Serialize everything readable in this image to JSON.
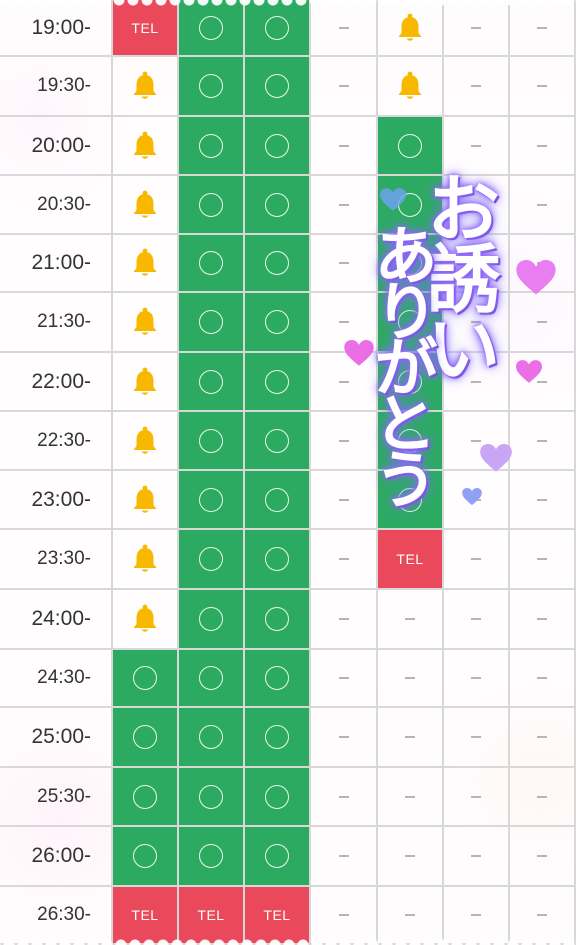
{
  "columns": [
    "c1",
    "c2",
    "c3",
    "c4",
    "c5",
    "c6",
    "c7"
  ],
  "rows": [
    {
      "time": "19:00-",
      "cells": [
        "tel",
        "circle",
        "circle",
        "dash",
        "bell",
        "dash",
        "dash"
      ]
    },
    {
      "time": "19:30-",
      "cells": [
        "bell",
        "circle",
        "circle",
        "dash",
        "bell",
        "dash",
        "dash"
      ]
    },
    {
      "time": "20:00-",
      "cells": [
        "bell",
        "circle",
        "circle",
        "dash",
        "circle",
        "dash",
        "dash"
      ]
    },
    {
      "time": "20:30-",
      "cells": [
        "bell",
        "circle",
        "circle",
        "dash",
        "circle",
        "dash",
        "dash"
      ]
    },
    {
      "time": "21:00-",
      "cells": [
        "bell",
        "circle",
        "circle",
        "dash",
        "circle",
        "dash",
        "dash"
      ]
    },
    {
      "time": "21:30-",
      "cells": [
        "bell",
        "circle",
        "circle",
        "dash",
        "circle",
        "dash",
        "dash"
      ]
    },
    {
      "time": "22:00-",
      "cells": [
        "bell",
        "circle",
        "circle",
        "dash",
        "circle",
        "dash",
        "dash"
      ]
    },
    {
      "time": "22:30-",
      "cells": [
        "bell",
        "circle",
        "circle",
        "dash",
        "circle",
        "dash",
        "dash"
      ]
    },
    {
      "time": "23:00-",
      "cells": [
        "bell",
        "circle",
        "circle",
        "dash",
        "circle",
        "dash",
        "dash"
      ]
    },
    {
      "time": "23:30-",
      "cells": [
        "bell",
        "circle",
        "circle",
        "dash",
        "tel",
        "dash",
        "dash"
      ]
    },
    {
      "time": "24:00-",
      "cells": [
        "bell",
        "circle",
        "circle",
        "dash",
        "dash",
        "dash",
        "dash"
      ]
    },
    {
      "time": "24:30-",
      "cells": [
        "circle",
        "circle",
        "circle",
        "dash",
        "dash",
        "dash",
        "dash"
      ]
    },
    {
      "time": "25:00-",
      "cells": [
        "circle",
        "circle",
        "circle",
        "dash",
        "dash",
        "dash",
        "dash"
      ]
    },
    {
      "time": "25:30-",
      "cells": [
        "circle",
        "circle",
        "circle",
        "dash",
        "dash",
        "dash",
        "dash"
      ]
    },
    {
      "time": "26:00-",
      "cells": [
        "circle",
        "circle",
        "circle",
        "dash",
        "dash",
        "dash",
        "dash"
      ]
    },
    {
      "time": "26:30-",
      "cells": [
        "tel",
        "tel",
        "tel",
        "dash",
        "dash",
        "dash",
        "dash"
      ]
    }
  ],
  "labels": {
    "tel": "TEL",
    "dash": "–"
  },
  "overlay": {
    "line1": "お誘い",
    "line2": "ありがとう"
  },
  "colors": {
    "available": "#2daa62",
    "tel": "#e9495a",
    "bell": "#f8b800",
    "grid_line": "#d8d8d8",
    "dash": "#b5b5b5",
    "overlay_glow": "#8a5cf0"
  },
  "icons": {
    "bell": "bell-icon",
    "circle": "available-circle-icon"
  }
}
